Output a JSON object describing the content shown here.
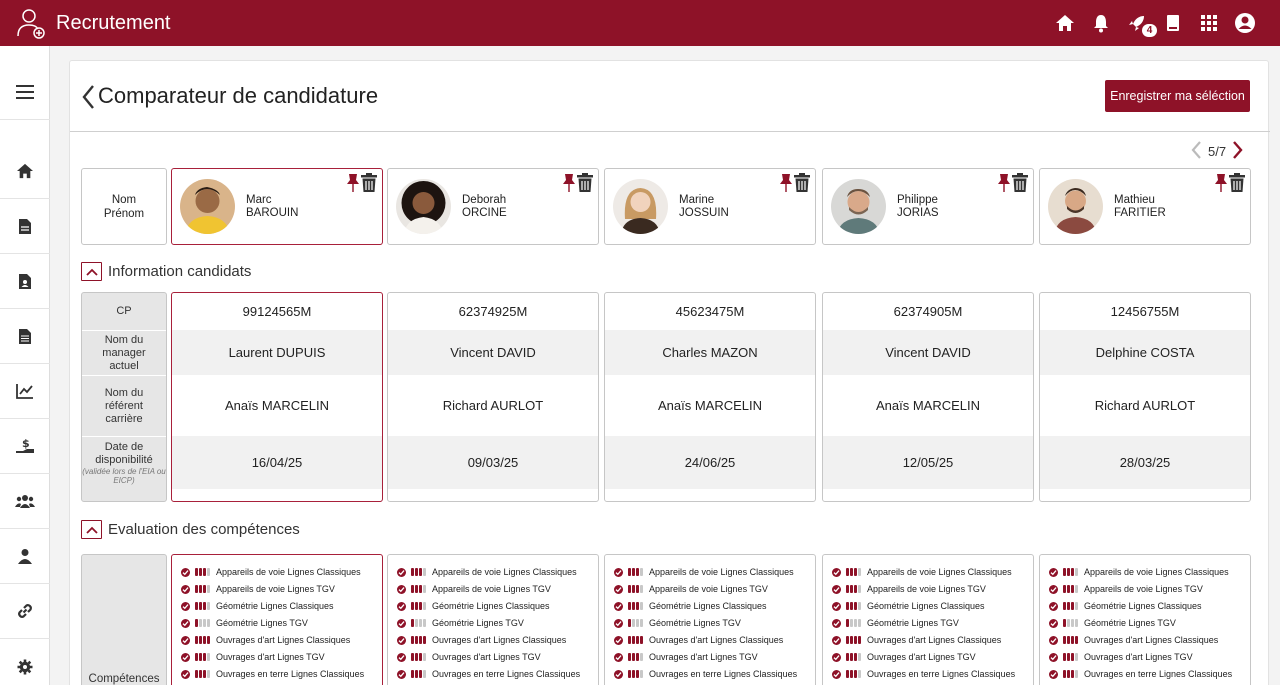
{
  "app": {
    "title": "Recrutement",
    "notifications_badge": "4"
  },
  "page": {
    "title": "Comparateur de candidature",
    "save_label": "Enregistrer ma séléction",
    "pager": "5/7"
  },
  "name_label": {
    "line1": "Nom",
    "line2": "Prénom"
  },
  "sections": {
    "info": "Information candidats",
    "skills": "Evaluation des compétences"
  },
  "info_labels": {
    "cp": "CP",
    "manager_1": "Nom du",
    "manager_2": "manager",
    "manager_3": "actuel",
    "referent_1": "Nom du",
    "referent_2": "référent",
    "referent_3": "carrière",
    "date_1": "Date de",
    "date_2": "disponibilité",
    "date_sub": "(validée lors de l'EIA ou EICP)"
  },
  "skills_label": "Compétences",
  "skill_names": [
    "Appareils de voie Lignes Classiques",
    "Appareils de voie Lignes TGV",
    "Géométrie Lignes Classiques",
    "Géométrie Lignes TGV",
    "Ouvrages d'art Lignes Classiques",
    "Ouvrages d'art Lignes TGV",
    "Ouvrages en terre Lignes Classiques"
  ],
  "candidates": [
    {
      "first": "Marc",
      "last": "BAROUIN",
      "cp": "99124565M",
      "manager": "Laurent DUPUIS",
      "referent": "Anaïs MARCELIN",
      "date": "16/04/25",
      "levels": [
        3,
        3,
        3,
        1,
        4,
        3,
        3
      ]
    },
    {
      "first": "Deborah",
      "last": "ORCINE",
      "cp": "62374925M",
      "manager": "Vincent DAVID",
      "referent": "Richard AURLOT",
      "date": "09/03/25",
      "levels": [
        3,
        3,
        3,
        1,
        4,
        3,
        3
      ]
    },
    {
      "first": "Marine",
      "last": "JOSSUIN",
      "cp": "45623475M",
      "manager": "Charles MAZON",
      "referent": "Anaïs MARCELIN",
      "date": "24/06/25",
      "levels": [
        3,
        3,
        3,
        1,
        4,
        3,
        3
      ]
    },
    {
      "first": "Philippe",
      "last": "JORIAS",
      "cp": "62374905M",
      "manager": "Vincent DAVID",
      "referent": "Anaïs MARCELIN",
      "date": "12/05/25",
      "levels": [
        3,
        3,
        3,
        1,
        4,
        3,
        3
      ]
    },
    {
      "first": "Mathieu",
      "last": "FARITIER",
      "cp": "12456755M",
      "manager": "Delphine COSTA",
      "referent": "Richard AURLOT",
      "date": "28/03/25",
      "levels": [
        3,
        3,
        3,
        1,
        4,
        3,
        3
      ]
    }
  ],
  "colors": {
    "brand": "#8e1228",
    "border": "#c6c6c6"
  }
}
